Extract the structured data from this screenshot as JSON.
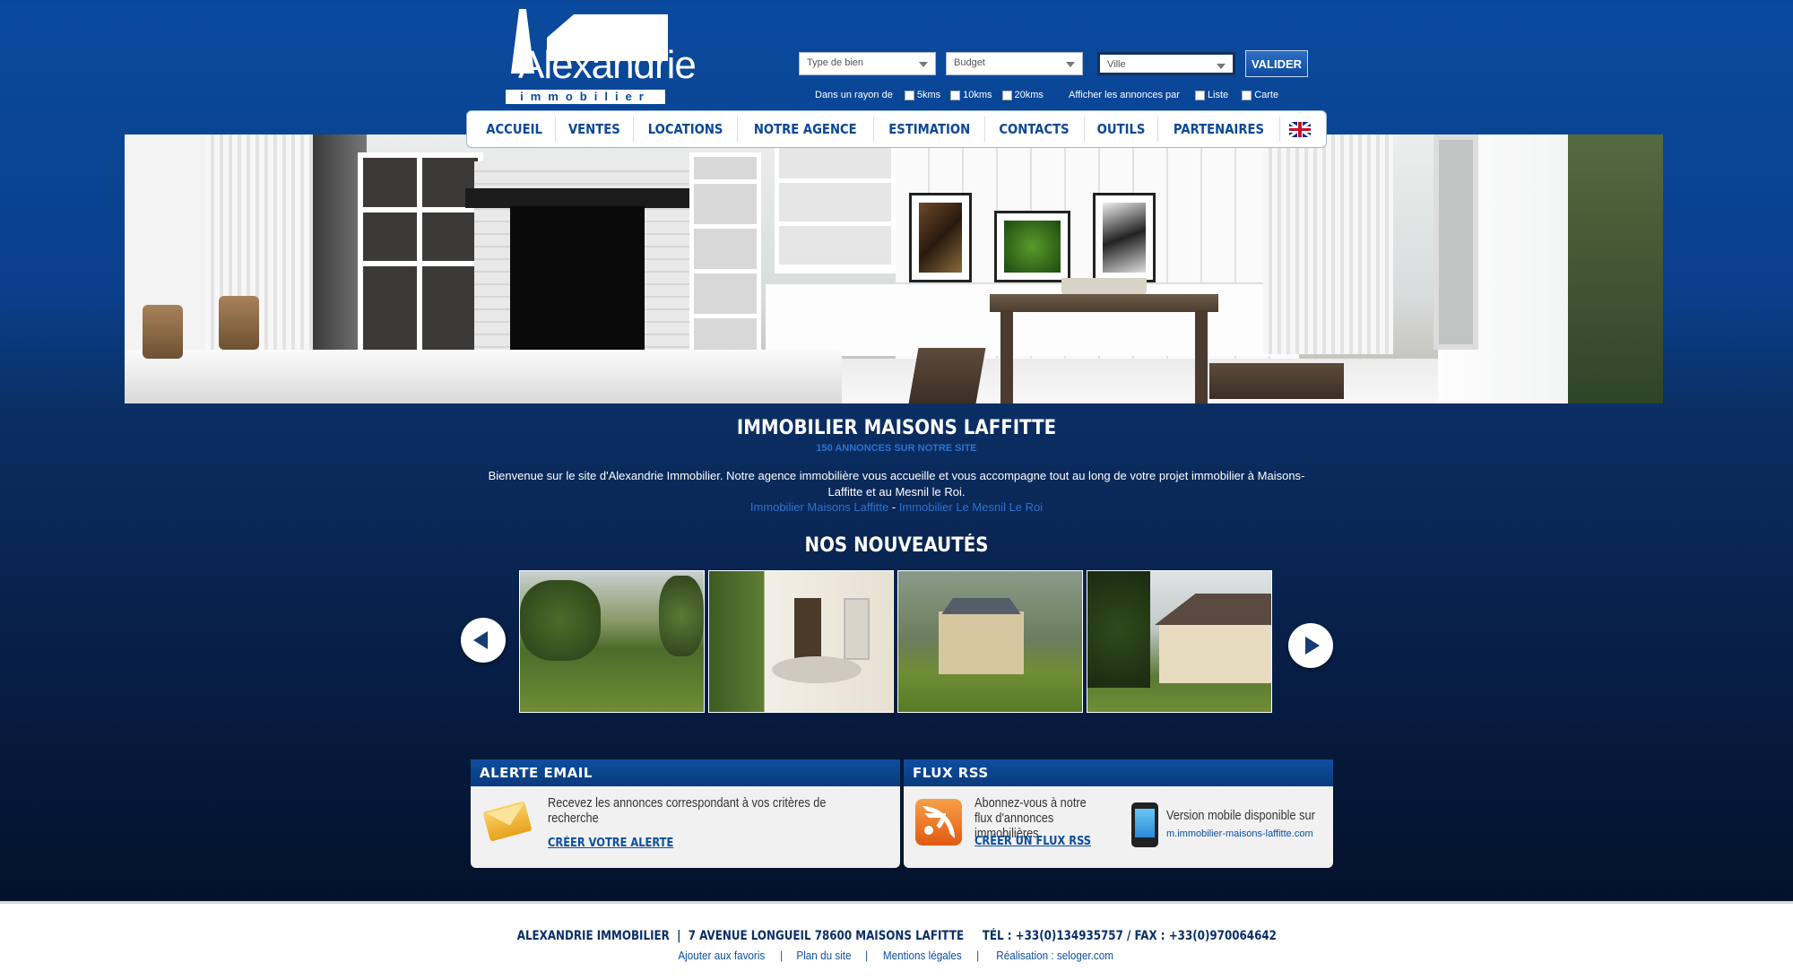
{
  "logo": {
    "line1": "Alexandrie",
    "line2": "immobilier"
  },
  "search": {
    "type_bien": "Type de bien",
    "budget": "Budget",
    "ville": "Ville",
    "submit": "VALIDER",
    "rayon_label": "Dans un rayon de",
    "rayon_options": [
      "5kms",
      "10kms",
      "20kms"
    ],
    "affichage_label": "Afficher les annonces par",
    "affichage_options": [
      "Liste",
      "Carte"
    ]
  },
  "nav": {
    "items": [
      "ACCUEIL",
      "VENTES",
      "LOCATIONS",
      "NOTRE AGENCE",
      "ESTIMATION",
      "CONTACTS",
      "OUTILS",
      "PARTENAIRES"
    ],
    "flag": "uk-flag-icon"
  },
  "main": {
    "title": "IMMOBILIER MAISONS LAFFITTE",
    "subtitle": "150 ANNONCES SUR NOTRE SITE",
    "intro": "Bienvenue sur le site d'Alexandrie Immobilier. Notre agence immobilière vous accueille et vous accompagne tout au long de votre projet immobilier à Maisons-Laffitte et au Mesnil le Roi.",
    "link1": "Immobilier Maisons Laffitte",
    "link_sep": " - ",
    "link2": "Immobilier Le Mesnil Le Roi",
    "nouveautes": "NOS NOUVEAUTÉS"
  },
  "alerte": {
    "header": "ALERTE EMAIL",
    "text": "Recevez les annonces correspondant à vos critères de recherche",
    "link": "CRÉER VOTRE ALERTE"
  },
  "rss": {
    "header": "FLUX RSS",
    "text": "Abonnez-vous à notre flux d'annonces immobilières.",
    "link": "CRÉER UN FLUX RSS",
    "mobile_text": "Version mobile disponible sur",
    "mobile_url": "m.immobilier-maisons-laffitte.com"
  },
  "footer": {
    "line1": "ALEXANDRIE IMMOBILIER  |  7 AVENUE LONGUEIL 78600 MAISONS LAFITTE     TÉL : +33(0)134935757 / FAX : +33(0)970064642",
    "links": [
      "Ajouter aux favoris",
      "Plan du site",
      "Mentions légales",
      "Réalisation : seloger.com"
    ],
    "sep": "|"
  },
  "colors": {
    "brand_blue": "#0a4a9e",
    "link_blue": "#2c73d0",
    "nav_text": "#0b4896"
  }
}
